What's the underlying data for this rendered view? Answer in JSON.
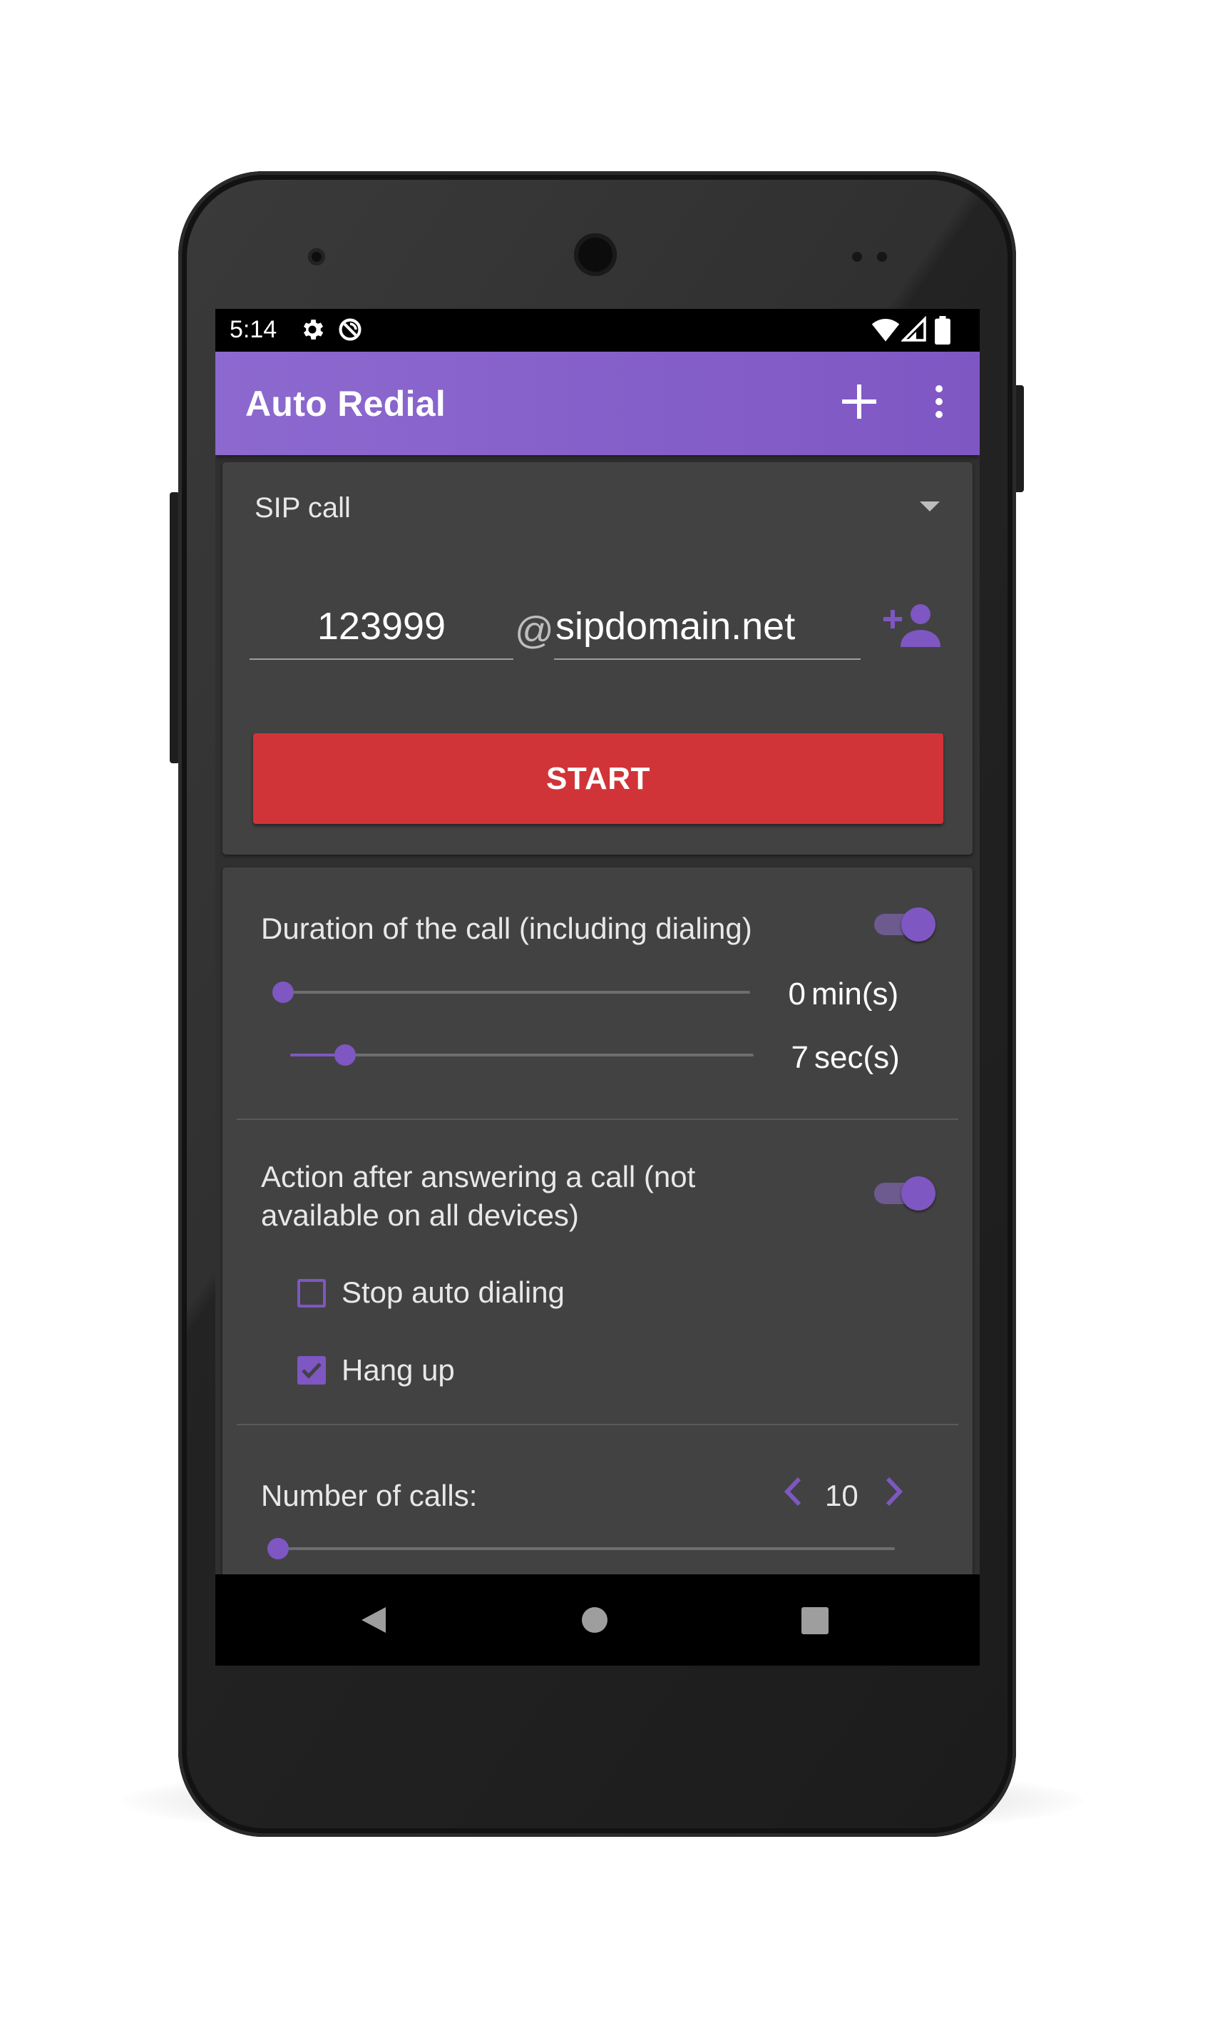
{
  "status_bar": {
    "time": "5:14",
    "icons": [
      "gear-icon",
      "sync-disabled-icon",
      "wifi-icon",
      "signal-icon",
      "battery-icon"
    ]
  },
  "app_bar": {
    "title": "Auto Redial",
    "add_icon": "plus-icon",
    "more_icon": "more-vertical-icon"
  },
  "call_card": {
    "call_type": "SIP call",
    "number": "123999",
    "at": "@",
    "domain": "sipdomain.net",
    "start_label": "START"
  },
  "settings_card": {
    "duration": {
      "title": "Duration of the call (including dialing)",
      "enabled": true,
      "minutes": {
        "value": 0,
        "max": 60,
        "unit": "min(s)"
      },
      "seconds": {
        "value": 7,
        "max": 59,
        "unit": "sec(s)"
      }
    },
    "after_answer": {
      "title_line1": "Action after answering a call (not",
      "title_line2": "available on all devices)",
      "enabled": true,
      "options": [
        {
          "label": "Stop auto dialing",
          "checked": false
        },
        {
          "label": "Hang up",
          "checked": true
        }
      ]
    },
    "number_of_calls": {
      "title": "Number of calls:",
      "value": "10",
      "slider_fraction": 0.0
    }
  },
  "colors": {
    "accent": "#7e57c2",
    "app_bar": "#8462c9",
    "start_button": "#d13438",
    "card": "#424242",
    "background": "#303030"
  }
}
